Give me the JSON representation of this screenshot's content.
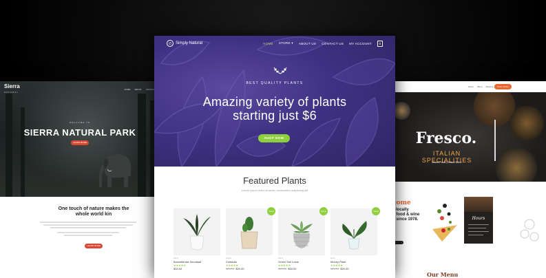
{
  "left_site": {
    "logo": "Sierra",
    "logo_sub": "NATURAL",
    "nav": [
      "HOME",
      "ABOUT",
      "CONTACT"
    ],
    "kicker": "WELCOME TO",
    "title": "SIERRA NATURAL PARK",
    "button": "LEARN MORE",
    "heading_line1": "One touch of nature makes the",
    "heading_line2": "whole world kin",
    "button2": "LEARN MORE"
  },
  "center_site": {
    "logo": "Simply Natural",
    "nav": [
      "HOME",
      "STORE",
      "ABOUT US",
      "CONTACT US",
      "MY ACCOUNT"
    ],
    "cart_count": "0",
    "kicker": "BEST QUALITY PLANTS",
    "title_line1": "Amazing variety of plants",
    "title_line2": "starting just $6",
    "cta": "SHOP NOW",
    "featured_title": "Featured Plants",
    "featured_sub": "Lorem ipsum dolor sit amet, consectetur adipiscing elit",
    "products": [
      {
        "category": "Plants",
        "name": "Boncellensis Secullant",
        "stars": "★★★★★",
        "old_price": "",
        "price": "$34.00",
        "sale": ""
      },
      {
        "category": "Cactus",
        "name": "Crassula",
        "stars": "★★★★★",
        "old_price": "$25.00",
        "price": "$20.00",
        "sale": "SALE"
      },
      {
        "category": "Plants",
        "name": "Green Soil Lotus",
        "stars": "★★★★★",
        "old_price": "$25.00",
        "price": "$34.00",
        "sale": "SALE"
      },
      {
        "category": "Plants",
        "name": "Money Plant",
        "stars": "★★★★★",
        "old_price": "$25.00",
        "price": "$20.00",
        "sale": "SALE"
      }
    ]
  },
  "right_site": {
    "nav": [
      "Home",
      "Menu",
      "Reserve",
      "Blog",
      "Contact"
    ],
    "order_button": "Order Online",
    "title": "Fresco.",
    "subtitle": "ITALIAN SPECIALITIES",
    "tagline": "Good Food | Good Wine",
    "welcome": "come",
    "welcome_line1": "e locally",
    "welcome_line2": "d food & wine",
    "welcome_line3": "g since 1978.",
    "hours_label": "Hours",
    "our_menu": "Our Menu"
  },
  "colors": {
    "plant_green": "#8dcf3d",
    "hero_purple": "#3f3182",
    "sierra_red": "#d94835",
    "fresco_orange": "#e8672f",
    "fresco_gold": "#f2a742"
  }
}
